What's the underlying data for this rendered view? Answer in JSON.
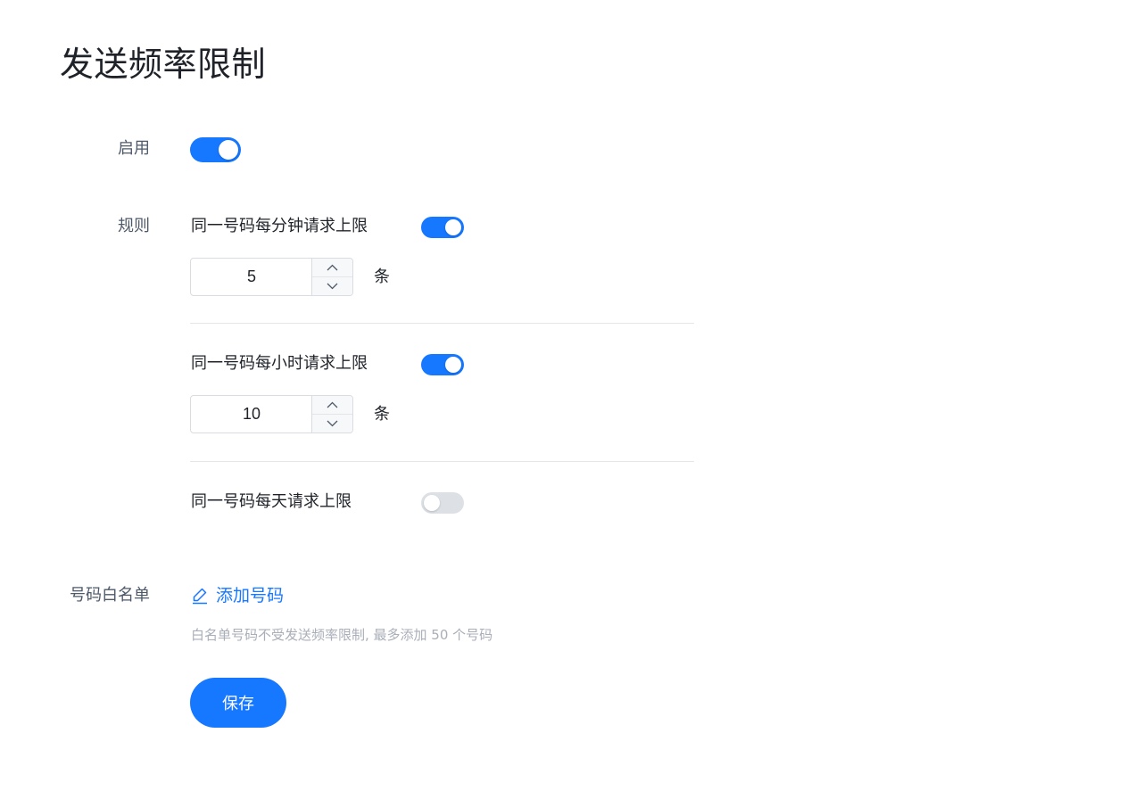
{
  "page": {
    "title": "发送频率限制"
  },
  "enable": {
    "label": "启用",
    "on": true
  },
  "rules": {
    "label": "规则",
    "items": [
      {
        "label": "同一号码每分钟请求上限",
        "on": true,
        "value": "5",
        "unit": "条"
      },
      {
        "label": "同一号码每小时请求上限",
        "on": true,
        "value": "10",
        "unit": "条"
      },
      {
        "label": "同一号码每天请求上限",
        "on": false
      }
    ]
  },
  "whitelist": {
    "label": "号码白名单",
    "add_link": "添加号码",
    "add_icon": "edit-icon",
    "hint": "白名单号码不受发送频率限制, 最多添加 50 个号码"
  },
  "actions": {
    "save_label": "保存"
  },
  "colors": {
    "accent": "#1677ff",
    "switch_off": "#dde1e6",
    "hint_text": "#a9aeb8"
  }
}
